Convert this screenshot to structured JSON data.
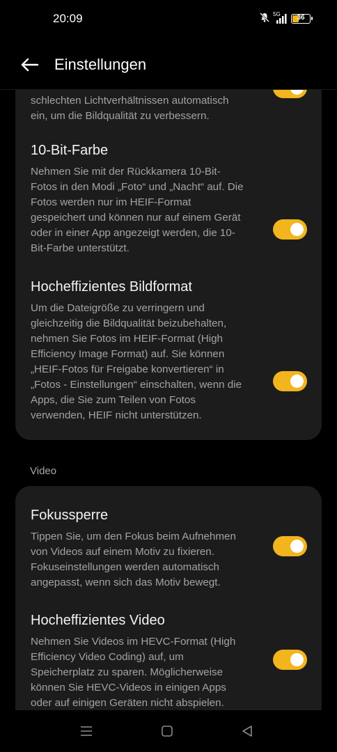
{
  "status": {
    "time": "20:09",
    "network": "5G",
    "battery": "36",
    "battery_level": 0.36,
    "icons": [
      "bell-muted-icon",
      "signal-icon",
      "battery-icon"
    ]
  },
  "header": {
    "title": "Einstellungen",
    "back_icon": "arrow-left-icon"
  },
  "photo_settings": {
    "partial_item": {
      "desc_lines": [
        "schlechten Lichtverhältnissen automatisch",
        "ein, um die Bildqualität zu verbessern."
      ],
      "enabled": true
    },
    "items": [
      {
        "title": "10-Bit-Farbe",
        "desc": "Nehmen Sie mit der Rückkamera 10-Bit-Fotos in den Modi „Foto“ und „Nacht“ auf. Die Fotos werden nur im HEIF-Format gespeichert und können nur auf einem Gerät oder in einer App angezeigt werden, die 10-Bit-Farbe unterstützt.",
        "enabled": true
      },
      {
        "title": "Hocheffizientes Bildformat",
        "desc": "Um die Dateigröße zu verringern und gleichzeitig die Bildqualität beizubehalten, nehmen Sie Fotos im HEIF-Format (High Efficiency Image Format) auf. Sie können „HEIF-Fotos für Freigabe konvertieren“ in „Fotos - Einstellungen“ einschalten, wenn die Apps, die Sie zum Teilen von Fotos verwenden, HEIF nicht unterstützen.",
        "enabled": true
      }
    ]
  },
  "video_section": {
    "label": "Video",
    "items": [
      {
        "title": "Fokussperre",
        "desc": "Tippen Sie, um den Fokus beim Aufnehmen von Videos auf einem Motiv zu fixieren. Fokuseinstellungen werden automatisch angepasst, wenn sich das Motiv bewegt.",
        "enabled": true
      },
      {
        "title": "Hocheffizientes Video",
        "desc": "Nehmen Sie Videos im HEVC-Format (High Efficiency Video Coding) auf, um Speicherplatz zu sparen. Möglicherweise können Sie HEVC-Videos in einigen Apps oder auf einigen Geräten nicht abspielen.",
        "enabled": true
      }
    ]
  },
  "navbar": {
    "icons": [
      "menu-icon",
      "home-icon",
      "back-triangle-icon"
    ]
  },
  "colors": {
    "accent": "#f3b51d",
    "card": "#1c1c1c",
    "background": "#000000"
  }
}
